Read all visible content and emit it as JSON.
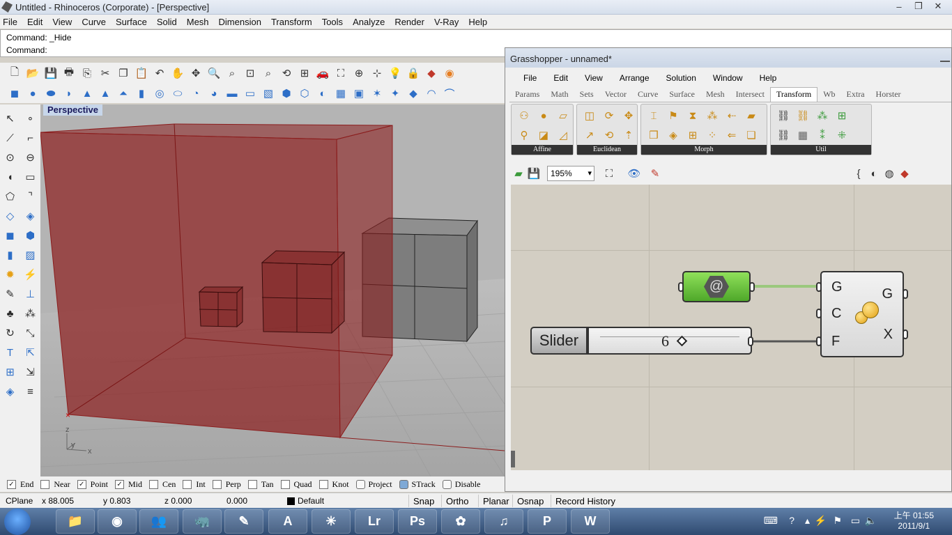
{
  "rhino": {
    "title": "Untitled - Rhinoceros (Corporate) - [Perspective]",
    "window_controls": [
      "–",
      "❐",
      "✕"
    ],
    "menu": [
      "File",
      "Edit",
      "View",
      "Curve",
      "Surface",
      "Solid",
      "Mesh",
      "Dimension",
      "Transform",
      "Tools",
      "Analyze",
      "Render",
      "V-Ray",
      "Help"
    ],
    "command_history": "Command: _Hide",
    "command_prompt": "Command:",
    "viewport_label": "Perspective",
    "axis_labels": {
      "z": "z",
      "y": "y",
      "x": "x"
    },
    "osnaps": [
      {
        "label": "End",
        "checked": true
      },
      {
        "label": "Near",
        "checked": false
      },
      {
        "label": "Point",
        "checked": true
      },
      {
        "label": "Mid",
        "checked": true
      },
      {
        "label": "Cen",
        "checked": false
      },
      {
        "label": "Int",
        "checked": false
      },
      {
        "label": "Perp",
        "checked": false
      },
      {
        "label": "Tan",
        "checked": false
      },
      {
        "label": "Quad",
        "checked": false
      },
      {
        "label": "Knot",
        "checked": false
      }
    ],
    "osnap_toggles": [
      {
        "label": "Project",
        "on": false
      },
      {
        "label": "STrack",
        "on": true
      },
      {
        "label": "Disable",
        "on": false
      }
    ],
    "status": {
      "cplane": "CPlane",
      "x": "x 88.005",
      "y": "y 0.803",
      "z": "z 0.000",
      "dist": "0.000",
      "layer": "Default",
      "panes": [
        "Snap",
        "Ortho",
        "Planar",
        "Osnap",
        "Record History"
      ]
    }
  },
  "grasshopper": {
    "title": "Grasshopper - unnamed*",
    "menu": [
      "File",
      "Edit",
      "View",
      "Arrange",
      "Solution",
      "Window",
      "Help"
    ],
    "tabs": [
      "Params",
      "Math",
      "Sets",
      "Vector",
      "Curve",
      "Surface",
      "Mesh",
      "Intersect",
      "Transform",
      "Wb",
      "Extra",
      "Horster"
    ],
    "active_tab": "Transform",
    "ribbon_groups": [
      "Affine",
      "Euclidean",
      "Morph",
      "Util"
    ],
    "zoom": "195%",
    "slider": {
      "label": "Slider",
      "value": "6"
    },
    "component": {
      "inputs": [
        "G",
        "C",
        "F"
      ],
      "outputs": [
        "G",
        "X"
      ]
    }
  },
  "taskbar": {
    "clock_time": "上午 01:55",
    "clock_date": "2011/9/1",
    "apps": [
      "Lr",
      "Ps",
      "P",
      "W"
    ]
  },
  "colors": {
    "box_red": "#8b1d1d",
    "wire_green": "#9bc87d",
    "gh_canvas": "#d3cec3",
    "green_param": "#6cc43a"
  }
}
